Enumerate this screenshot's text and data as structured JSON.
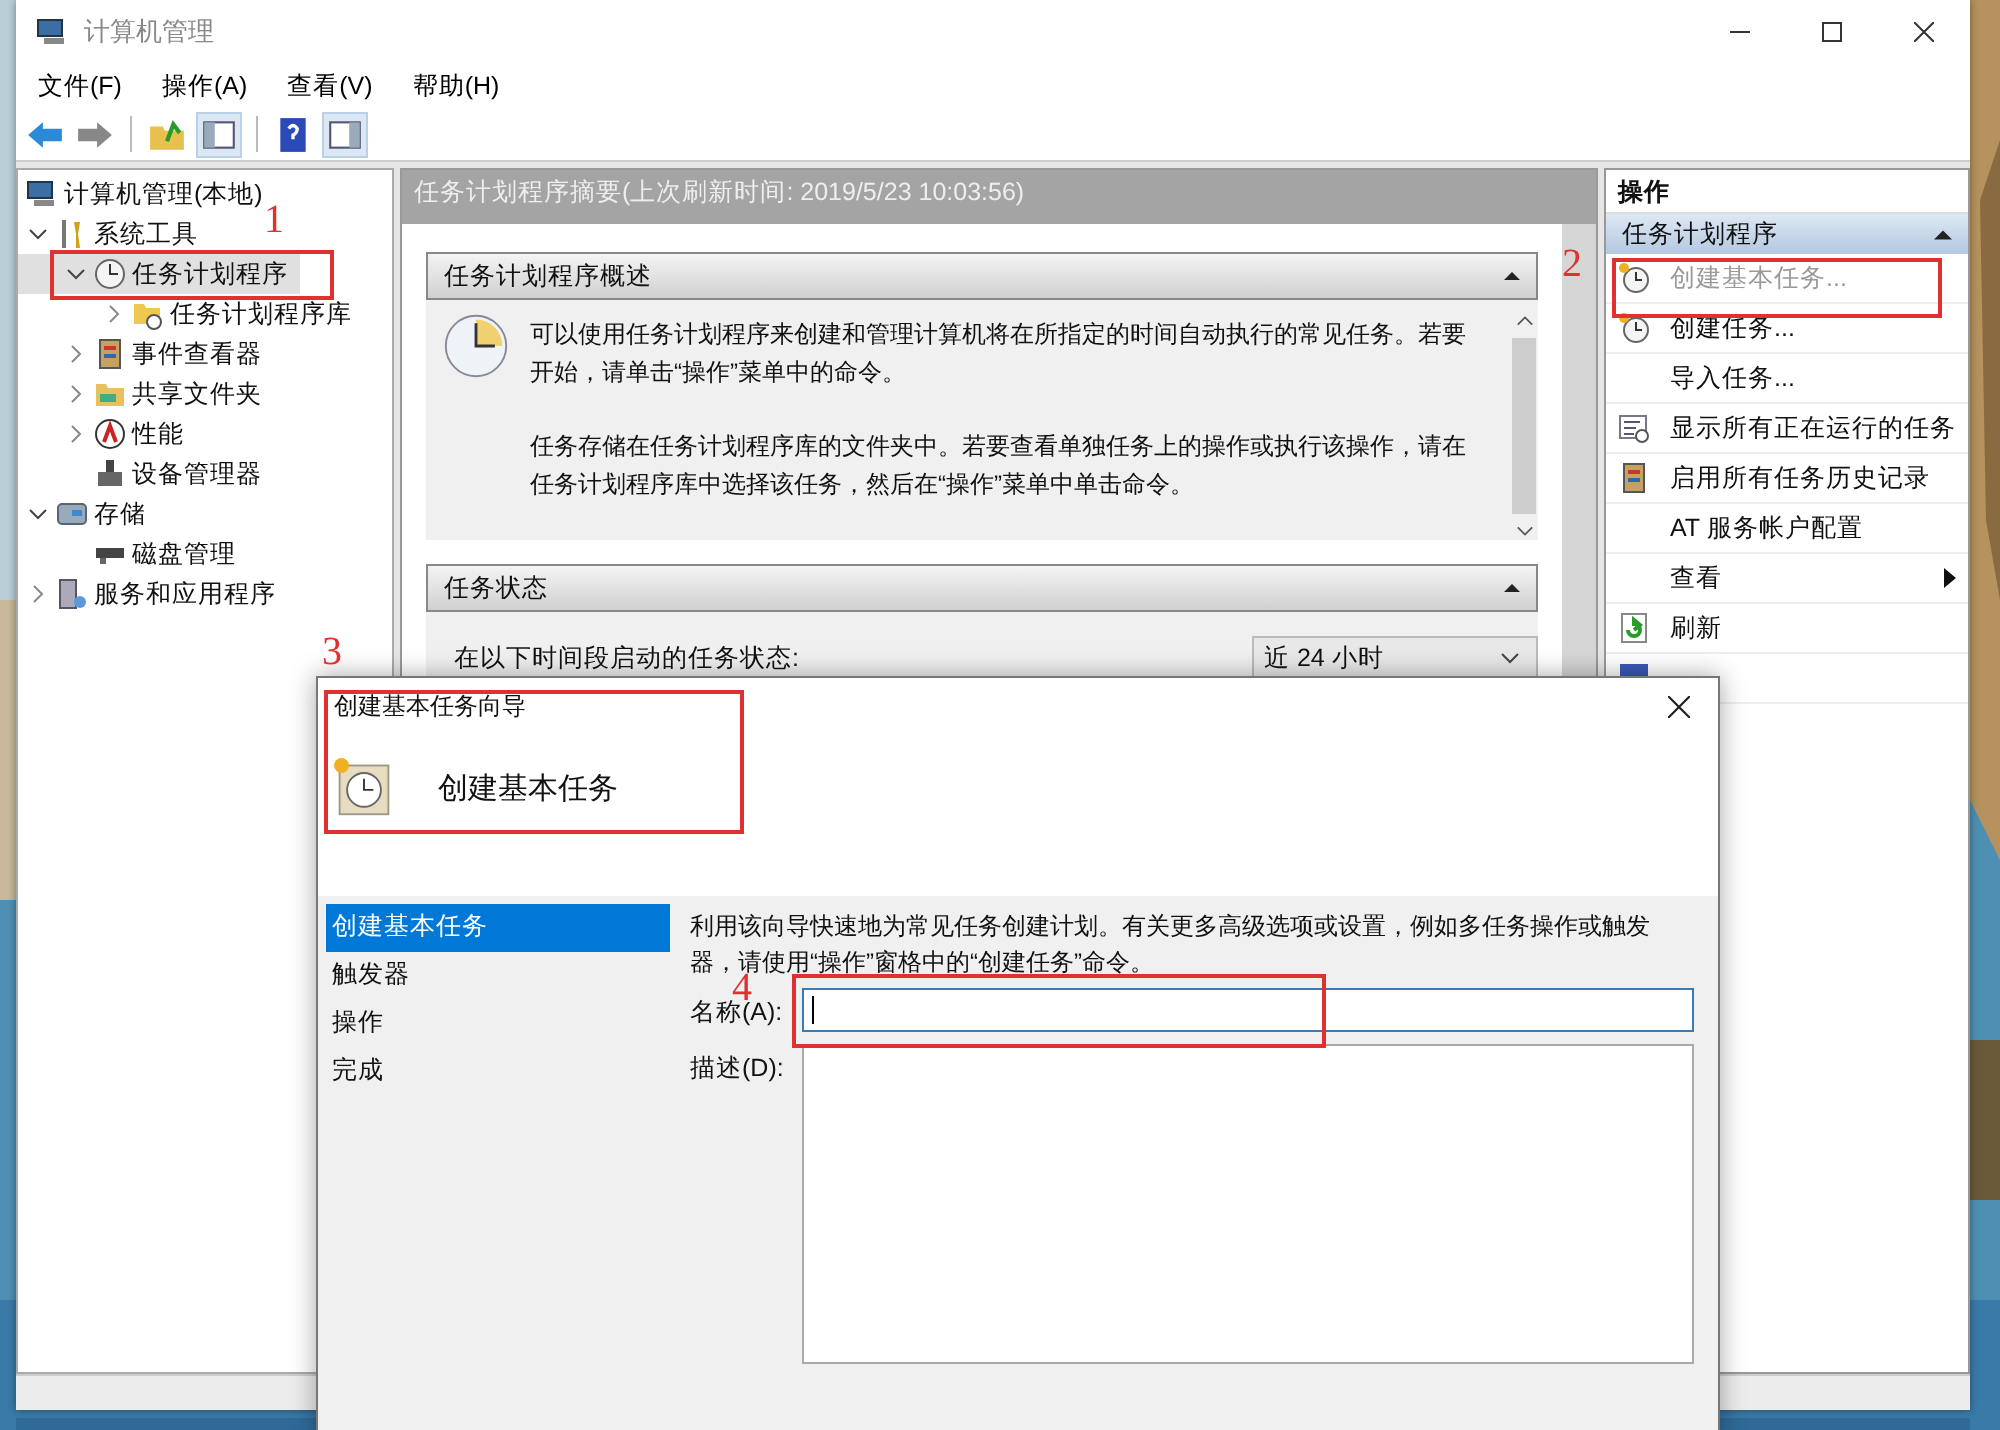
{
  "window": {
    "title": "计算机管理",
    "menus": [
      "文件(F)",
      "操作(A)",
      "查看(V)",
      "帮助(H)"
    ]
  },
  "tree": [
    {
      "label": "计算机管理(本地)",
      "selected": false,
      "children": [
        {
          "label": "系统工具",
          "expanded": true,
          "selected": false,
          "children": [
            {
              "label": "任务计划程序",
              "expanded": true,
              "selected": true,
              "children": [
                {
                  "label": "任务计划程序库",
                  "expanded": false,
                  "selected": false
                }
              ]
            },
            {
              "label": "事件查看器",
              "expanded": false,
              "selected": false
            },
            {
              "label": "共享文件夹",
              "expanded": false,
              "selected": false
            },
            {
              "label": "性能",
              "expanded": false,
              "selected": false
            },
            {
              "label": "设备管理器",
              "selected": false
            }
          ]
        },
        {
          "label": "存储",
          "expanded": true,
          "selected": false,
          "children": [
            {
              "label": "磁盘管理",
              "selected": false
            }
          ]
        },
        {
          "label": "服务和应用程序",
          "expanded": false,
          "selected": false
        }
      ]
    }
  ],
  "center": {
    "header": "任务计划程序摘要(上次刷新时间: 2019/5/23 10:03:56)",
    "sections": [
      {
        "title": "任务计划程序概述",
        "expanded": true,
        "paragraphs": [
          "可以使用任务计划程序来创建和管理计算机将在所指定的时间自动执行的常见任务。若要开始，请单击“操作”菜单中的命令。",
          "任务存储在任务计划程序库的文件夹中。若要查看单独任务上的操作或执行该操作，请在任务计划程序库中选择该任务，然后在“操作”菜单中单击命令。"
        ]
      },
      {
        "title": "任务状态",
        "expanded": true,
        "label": "在以下时间段启动的任务状态:",
        "dropdown": "近 24 小时"
      }
    ]
  },
  "actions": {
    "title": "操作",
    "group": "任务计划程序",
    "items": [
      {
        "label": "创建基本任务...",
        "disabled": true,
        "submenu": false
      },
      {
        "label": "创建任务...",
        "disabled": false,
        "submenu": false
      },
      {
        "label": "导入任务...",
        "disabled": false,
        "submenu": false
      },
      {
        "label": "显示所有正在运行的任务",
        "disabled": false,
        "submenu": false
      },
      {
        "label": "启用所有任务历史记录",
        "disabled": false,
        "submenu": false
      },
      {
        "label": "AT 服务帐户配置",
        "disabled": false,
        "submenu": false
      },
      {
        "label": "查看",
        "disabled": false,
        "submenu": true
      },
      {
        "label": "刷新",
        "disabled": false,
        "submenu": false
      }
    ]
  },
  "dialog": {
    "title": "创建基本任务向导",
    "heading": "创建基本任务",
    "steps": [
      {
        "label": "创建基本任务",
        "selected": true
      },
      {
        "label": "触发器",
        "selected": false
      },
      {
        "label": "操作",
        "selected": false
      },
      {
        "label": "完成",
        "selected": false
      }
    ],
    "intro": "利用该向导快速地为常见任务创建计划。有关更多高级选项或设置，例如多任务操作或触发器，请使用“操作”窗格中的“创建任务”命令。",
    "fields": [
      {
        "label": "名称(A):",
        "kind": "line"
      },
      {
        "label": "描述(D):",
        "kind": "area"
      }
    ]
  },
  "annotations": [
    "1",
    "2",
    "3",
    "4"
  ]
}
